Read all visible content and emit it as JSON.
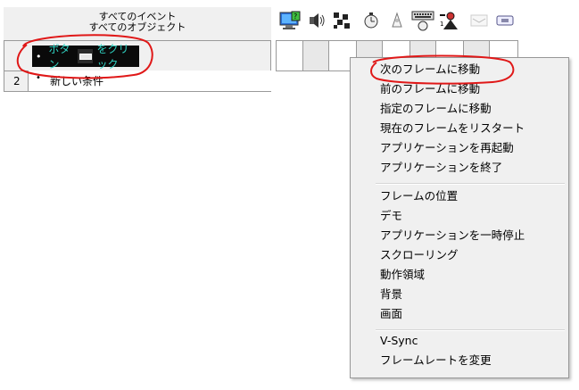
{
  "header": {
    "line1": "すべてのイベント",
    "line2": "すべてのオブジェクト"
  },
  "object_icons": [
    "computer-icon",
    "speaker-icon",
    "grid-icon",
    "timer-icon",
    "create-icon",
    "keyboard-mouse-icon",
    "player-icon",
    "storyboard-icon",
    "button-object-icon"
  ],
  "events": [
    {
      "number": "",
      "condition": {
        "bullet": "•",
        "parts": [
          "ボタン",
          "をクリック"
        ]
      }
    },
    {
      "number": "2",
      "condition": {
        "bullet": "•",
        "text": "新しい条件"
      }
    }
  ],
  "context_menu": {
    "groups": [
      [
        {
          "label": "次のフレームに移動",
          "submenu": false
        },
        {
          "label": "前のフレームに移動",
          "submenu": false
        },
        {
          "label": "指定のフレームに移動",
          "submenu": false
        },
        {
          "label": "現在のフレームをリスタート",
          "submenu": false
        },
        {
          "label": "アプリケーションを再起動",
          "submenu": false
        },
        {
          "label": "アプリケーションを終了",
          "submenu": false
        }
      ],
      [
        {
          "label": "フレームの位置",
          "submenu": true
        },
        {
          "label": "デモ",
          "submenu": true
        },
        {
          "label": "アプリケーションを一時停止",
          "submenu": true
        },
        {
          "label": "スクローリング",
          "submenu": true
        },
        {
          "label": "動作領域",
          "submenu": true
        },
        {
          "label": "背景",
          "submenu": true
        },
        {
          "label": "画面",
          "submenu": true
        }
      ],
      [
        {
          "label": "V-Sync",
          "submenu": true
        },
        {
          "label": "フレームレートを変更",
          "submenu": false
        }
      ]
    ]
  },
  "colors": {
    "marker": "#e01818",
    "condition_bg": "#0a0a0a",
    "condition_text": "#2fd3c3",
    "menu_bg": "#f0f0f0"
  }
}
